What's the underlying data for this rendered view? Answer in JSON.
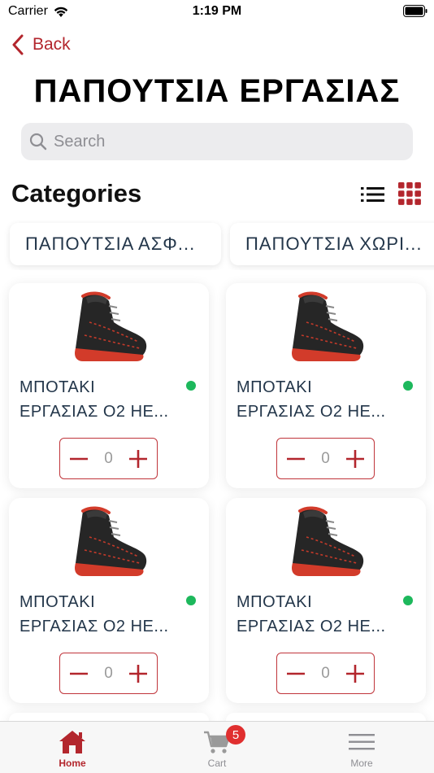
{
  "status_bar": {
    "carrier": "Carrier",
    "time": "1:19 PM"
  },
  "nav": {
    "back_label": "Back"
  },
  "page": {
    "title": "ΠΑΠΟΥΤΣΙΑ ΕΡΓΑΣΙΑΣ"
  },
  "search": {
    "placeholder": "Search",
    "value": ""
  },
  "categories": {
    "title": "Categories",
    "items": [
      {
        "label": "ΠΑΠΟΥΤΣΙΑ ΑΣΦ..."
      },
      {
        "label": "ΠΑΠΟΥΤΣΙΑ ΧΩΡΙ..."
      }
    ]
  },
  "products": [
    {
      "name_line1": "ΜΠΟΤΑΚΙ",
      "name_line2": "ΕΡΓΑΣΙΑΣ Ο2 ΗΕ...",
      "quantity": "0",
      "in_stock": true
    },
    {
      "name_line1": "ΜΠΟΤΑΚΙ",
      "name_line2": "ΕΡΓΑΣΙΑΣ Ο2 ΗΕ...",
      "quantity": "0",
      "in_stock": true
    },
    {
      "name_line1": "ΜΠΟΤΑΚΙ",
      "name_line2": "ΕΡΓΑΣΙΑΣ Ο2 ΗΕ...",
      "quantity": "0",
      "in_stock": true
    },
    {
      "name_line1": "ΜΠΟΤΑΚΙ",
      "name_line2": "ΕΡΓΑΣΙΑΣ Ο2 ΗΕ...",
      "quantity": "0",
      "in_stock": true
    }
  ],
  "tabs": [
    {
      "label": "Home",
      "icon": "home-icon",
      "active": true
    },
    {
      "label": "Cart",
      "icon": "cart-icon",
      "active": false,
      "badge": "5"
    },
    {
      "label": "More",
      "icon": "menu-icon",
      "active": false
    }
  ],
  "colors": {
    "accent": "#b3262d",
    "stock": "#1db85c",
    "badge": "#e02f2f",
    "text": "#23364a"
  }
}
